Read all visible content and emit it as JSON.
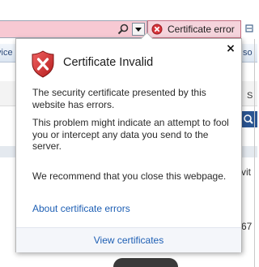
{
  "toolbar": {
    "cert_error_label": "Certificate error"
  },
  "background": {
    "left_text": "vice",
    "right_text_top": "so",
    "right_text_mid": "S",
    "right_text_vit": "vit",
    "right_text_67": "67"
  },
  "popup": {
    "title": "Certificate Invalid",
    "close_symbol": "×",
    "paragraph1": "The security certificate presented by this website has errors.",
    "paragraph2": "This problem might indicate an attempt to fool you or intercept any data you send to the server.",
    "paragraph3": "We recommend that you close this webpage.",
    "about_link": "About certificate errors",
    "view_link": "View certificates"
  },
  "icons": {
    "shield": "shield-error-icon",
    "search": "search-icon",
    "dropdown": "chevron-down-icon",
    "cert_error": "error-x-icon",
    "close": "close-icon"
  },
  "colors": {
    "address_bar_error": "#f7c9d3",
    "shield_red": "#d12b2b",
    "link_blue": "#1e5fb4"
  }
}
